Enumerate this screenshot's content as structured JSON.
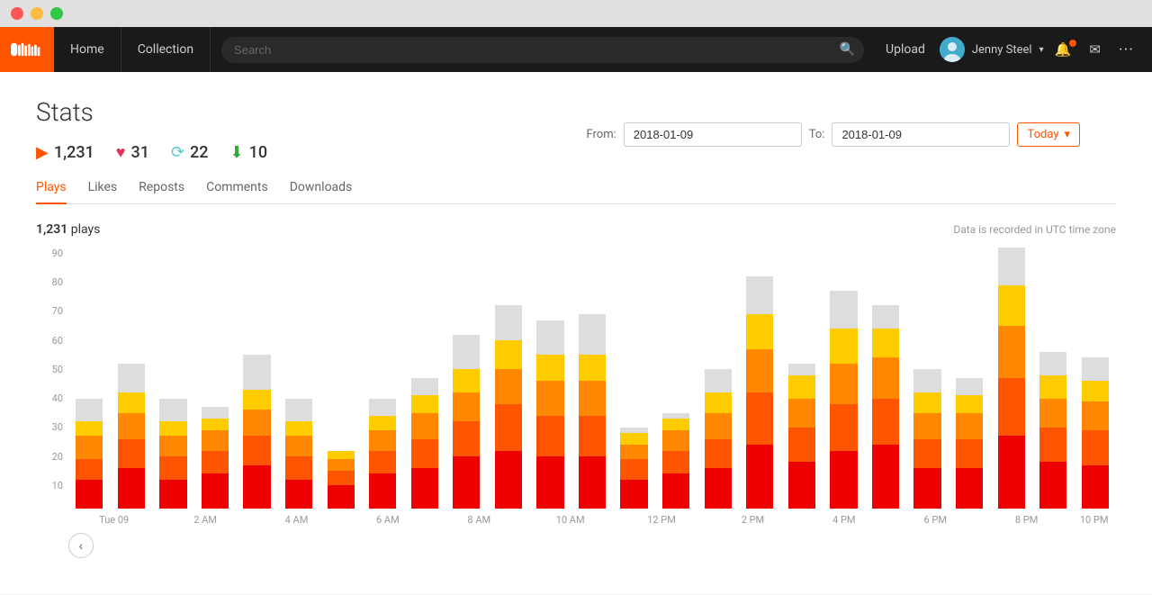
{
  "window": {
    "buttons": [
      "close",
      "minimize",
      "maximize"
    ]
  },
  "navbar": {
    "logo_alt": "SoundCloud",
    "home_label": "Home",
    "collection_label": "Collection",
    "search_placeholder": "Search",
    "upload_label": "Upload",
    "username": "Jenny Steel",
    "bell_icon": "🔔",
    "mail_icon": "✉",
    "more_icon": "···"
  },
  "page": {
    "title": "Stats",
    "date_from_label": "From:",
    "date_from_value": "2018-01-09",
    "date_to_label": "To:",
    "date_to_value": "2018-01-09",
    "today_label": "Today",
    "stats": {
      "plays": "1,231",
      "likes": "31",
      "reposts": "22",
      "downloads": "10"
    },
    "tabs": [
      "Plays",
      "Likes",
      "Reposts",
      "Comments",
      "Downloads"
    ],
    "active_tab": "Plays",
    "chart": {
      "plays_count": "1,231",
      "plays_unit": "plays",
      "utc_note": "Data is recorded in UTC time zone",
      "y_labels": [
        "10",
        "20",
        "30",
        "40",
        "50",
        "60",
        "70",
        "80",
        "90"
      ],
      "x_labels": [
        "Tue 09",
        "2 AM",
        "4 AM",
        "6 AM",
        "8 AM",
        "10 AM",
        "12 PM",
        "2 PM",
        "4 PM",
        "6 PM",
        "8 PM",
        "10 PM"
      ],
      "bars": [
        {
          "total": 38,
          "segments": [
            10,
            7,
            8,
            5
          ]
        },
        {
          "total": 50,
          "segments": [
            14,
            10,
            9,
            7
          ]
        },
        {
          "total": 38,
          "segments": [
            10,
            8,
            7,
            5
          ]
        },
        {
          "total": 35,
          "segments": [
            12,
            8,
            7,
            4
          ]
        },
        {
          "total": 53,
          "segments": [
            15,
            10,
            9,
            7
          ]
        },
        {
          "total": 38,
          "segments": [
            10,
            8,
            7,
            5
          ]
        },
        {
          "total": 20,
          "segments": [
            8,
            5,
            4,
            3
          ]
        },
        {
          "total": 38,
          "segments": [
            12,
            8,
            7,
            5
          ]
        },
        {
          "total": 45,
          "segments": [
            14,
            10,
            9,
            6
          ]
        },
        {
          "total": 60,
          "segments": [
            18,
            12,
            10,
            8
          ]
        },
        {
          "total": 70,
          "segments": [
            20,
            16,
            12,
            10
          ]
        },
        {
          "total": 65,
          "segments": [
            18,
            14,
            12,
            9
          ]
        },
        {
          "total": 67,
          "segments": [
            18,
            14,
            12,
            9
          ]
        },
        {
          "total": 28,
          "segments": [
            10,
            7,
            5,
            4
          ]
        },
        {
          "total": 33,
          "segments": [
            12,
            8,
            7,
            4
          ]
        },
        {
          "total": 48,
          "segments": [
            14,
            10,
            9,
            7
          ]
        },
        {
          "total": 80,
          "segments": [
            22,
            18,
            15,
            12
          ]
        },
        {
          "total": 50,
          "segments": [
            16,
            12,
            10,
            8
          ]
        },
        {
          "total": 75,
          "segments": [
            20,
            16,
            14,
            12
          ]
        },
        {
          "total": 70,
          "segments": [
            22,
            16,
            14,
            10
          ]
        },
        {
          "total": 48,
          "segments": [
            14,
            10,
            9,
            7
          ]
        },
        {
          "total": 45,
          "segments": [
            14,
            10,
            9,
            6
          ]
        },
        {
          "total": 90,
          "segments": [
            25,
            20,
            18,
            14
          ]
        },
        {
          "total": 54,
          "segments": [
            16,
            12,
            10,
            8
          ]
        },
        {
          "total": 52,
          "segments": [
            15,
            12,
            10,
            7
          ]
        }
      ]
    }
  }
}
